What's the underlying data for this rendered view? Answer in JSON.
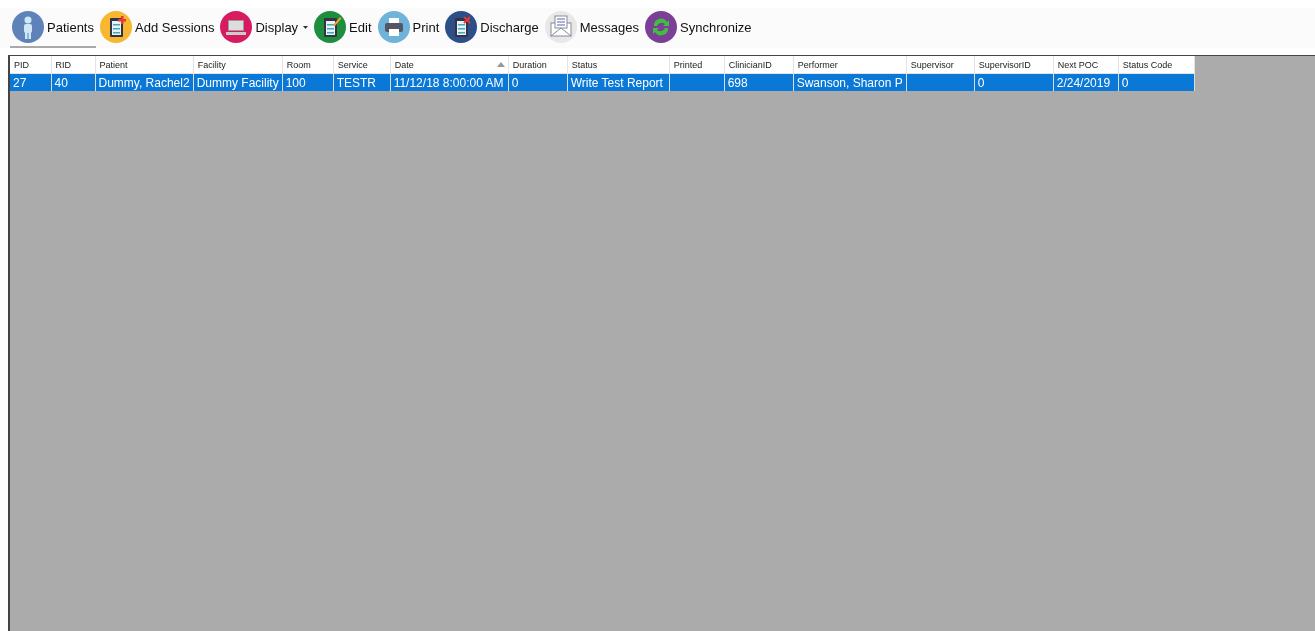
{
  "toolbar": [
    {
      "label": "Patients",
      "kind": "person",
      "selected": true,
      "dropdown": false
    },
    {
      "label": "Add Sessions",
      "kind": "clipboardadd",
      "selected": false,
      "dropdown": false
    },
    {
      "label": "Display",
      "kind": "monitor",
      "selected": false,
      "dropdown": true
    },
    {
      "label": "Edit",
      "kind": "clipboardedit",
      "selected": false,
      "dropdown": false
    },
    {
      "label": "Print",
      "kind": "printer",
      "selected": false,
      "dropdown": false
    },
    {
      "label": "Discharge",
      "kind": "clipboardremove",
      "selected": false,
      "dropdown": false
    },
    {
      "label": "Messages",
      "kind": "envelope",
      "selected": false,
      "dropdown": false
    },
    {
      "label": "Synchronize",
      "kind": "sync",
      "selected": false,
      "dropdown": false
    }
  ],
  "table": {
    "columns": [
      {
        "label": "PID",
        "sorted": false
      },
      {
        "label": "RID",
        "sorted": false
      },
      {
        "label": "Patient",
        "sorted": false
      },
      {
        "label": "Facility",
        "sorted": false
      },
      {
        "label": "Room",
        "sorted": false
      },
      {
        "label": "Service",
        "sorted": false
      },
      {
        "label": "Date",
        "sorted": true
      },
      {
        "label": "Duration",
        "sorted": false
      },
      {
        "label": "Status",
        "sorted": false
      },
      {
        "label": "Printed",
        "sorted": false
      },
      {
        "label": "ClinicianID",
        "sorted": false
      },
      {
        "label": "Performer",
        "sorted": false
      },
      {
        "label": "Supervisor",
        "sorted": false
      },
      {
        "label": "SupervisorID",
        "sorted": false
      },
      {
        "label": "Next POC",
        "sorted": false
      },
      {
        "label": "Status Code",
        "sorted": false
      }
    ],
    "rows": [
      {
        "selected": true,
        "cells": [
          "27",
          "40",
          "Dummy, Rachel2",
          "Dummy Facility",
          "100",
          "TESTR",
          "11/12/18 8:00:00 AM",
          "0",
          "Write Test Report",
          "",
          "698",
          "Swanson, Sharon P",
          "",
          "0",
          "2/24/2019",
          "0"
        ]
      }
    ]
  }
}
